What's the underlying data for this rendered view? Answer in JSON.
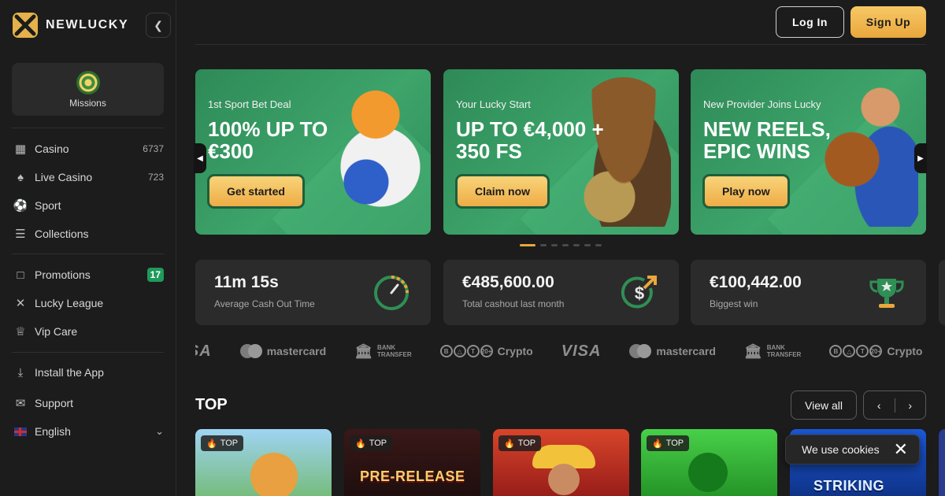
{
  "brand": {
    "name": "NEWLUCKY"
  },
  "sidebar": {
    "missions_label": "Missions",
    "items": [
      {
        "icon": "casino-icon",
        "label": "Casino",
        "count": "6737"
      },
      {
        "icon": "live-casino-icon",
        "label": "Live Casino",
        "count": "723"
      },
      {
        "icon": "sport-icon",
        "label": "Sport"
      },
      {
        "icon": "collections-icon",
        "label": "Collections"
      },
      {
        "icon": "promotions-icon",
        "label": "Promotions",
        "badge": "17"
      },
      {
        "icon": "lucky-league-icon",
        "label": "Lucky League"
      },
      {
        "icon": "vip-care-icon",
        "label": "Vip Care"
      },
      {
        "icon": "install-app-icon",
        "label": "Install the App"
      },
      {
        "icon": "support-icon",
        "label": "Support"
      },
      {
        "icon": "uk-flag-icon",
        "label": "English"
      }
    ]
  },
  "header": {
    "login_label": "Log In",
    "signup_label": "Sign Up"
  },
  "banners": [
    {
      "subtitle": "1st Sport Bet Deal",
      "title": "100% UP TO €300",
      "button": "Get started"
    },
    {
      "subtitle": "Your Lucky Start",
      "title": "UP TO €4,000 + 350 FS",
      "button": "Claim now"
    },
    {
      "subtitle": "New Provider Joins Lucky",
      "title": "NEW REELS, EPIC WINS",
      "button": "Play now"
    }
  ],
  "carousel": {
    "total": 8,
    "active": 0
  },
  "stats": [
    {
      "value": "11m 15s",
      "label": "Average Cash Out Time",
      "icon": "speedometer-icon"
    },
    {
      "value": "€485,600.00",
      "label": "Total cashout last month",
      "icon": "dollar-arrow-icon"
    },
    {
      "value": "€100,442.00",
      "label": "Biggest win",
      "icon": "trophy-icon"
    }
  ],
  "payments": {
    "mastercard": "mastercard",
    "bank_line1": "BANK",
    "bank_line2": "TRANSFER",
    "crypto": "Crypto",
    "visa": "VISA",
    "coin_labels": [
      "B",
      "T",
      "20+"
    ]
  },
  "top_section": {
    "title": "TOP",
    "view_all": "View all",
    "prev": "‹",
    "next": "›",
    "tag": "TOP",
    "games": [
      {
        "name": ""
      },
      {
        "name": "PRE-RELEASE"
      },
      {
        "name": ""
      },
      {
        "name": ""
      },
      {
        "name": "STRIKING"
      }
    ]
  },
  "cookie": {
    "text": "We use cookies",
    "close": "✕"
  },
  "colors": {
    "accent": "#e9a73c",
    "banner_green": "#3da46a",
    "badge_green": "#1f9a5a",
    "background": "#1c1c1c",
    "card": "#2b2b2b"
  }
}
